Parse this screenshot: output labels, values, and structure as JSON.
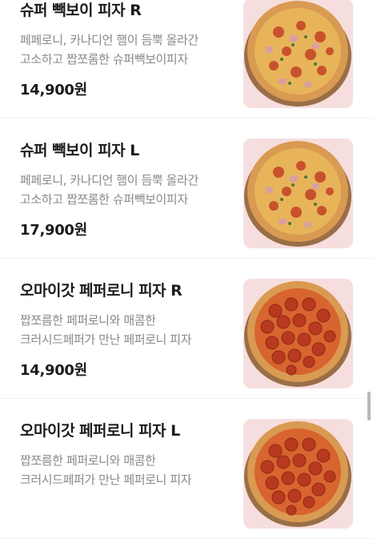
{
  "menu_items": [
    {
      "name": "슈퍼 빽보이 피자 R",
      "description": "페페로니, 카나디언 햄이 듬뿍 올라간 고소하고 짭쪼롬한 슈퍼빽보이피자",
      "price": "14,900원",
      "image_icon": "super-backboy-pizza-image"
    },
    {
      "name": "슈퍼 빽보이 피자 L",
      "description": "페페로니, 카나디언 햄이 듬뿍 올라간 고소하고 짭쪼롬한 슈퍼빽보이피자",
      "price": "17,900원",
      "image_icon": "super-backboy-pizza-image"
    },
    {
      "name": "오마이갓 페퍼로니 피자 R",
      "description": "짭쪼름한 페퍼로니와 매콤한 크러시드페퍼가 만난 페퍼로니 피자",
      "price": "14,900원",
      "image_icon": "pepperoni-pizza-image"
    },
    {
      "name": "오마이갓 페퍼로니 피자 L",
      "description": "짭쪼름한 페퍼로니와 매콤한 크러시드페퍼가 만난 페퍼로니 피자",
      "price": "",
      "image_icon": "pepperoni-pizza-image"
    }
  ],
  "colors": {
    "thumb_background": "#f7dede",
    "crust": "#d99a52",
    "cheese": "#e7b45a",
    "pepperoni": "#b8391f",
    "price_text": "#1b1b1b",
    "description_text": "#8a8a8a"
  }
}
